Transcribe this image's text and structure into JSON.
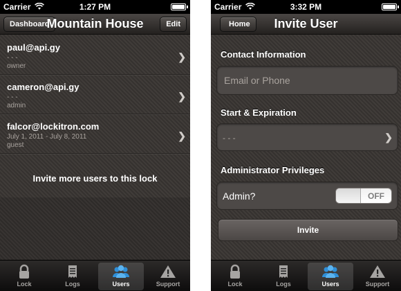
{
  "left": {
    "status": {
      "carrier": "Carrier",
      "time": "1:27 PM"
    },
    "navbar": {
      "left_button": "Dashboard",
      "title": "Mountain House",
      "right_button": "Edit"
    },
    "users": [
      {
        "email": "paul@api.gy",
        "dates": "- - -",
        "role": "owner"
      },
      {
        "email": "cameron@api.gy",
        "dates": "- - -",
        "role": "admin"
      },
      {
        "email": "falcor@lockitron.com",
        "dates": "July 1, 2011 - July 8, 2011",
        "role": "guest"
      }
    ],
    "invite_more": "Invite more users to this lock"
  },
  "right": {
    "status": {
      "carrier": "Carrier",
      "time": "3:32 PM"
    },
    "navbar": {
      "back_button": "Home",
      "title": "Invite User"
    },
    "contact": {
      "label": "Contact Information",
      "placeholder": "Email or Phone"
    },
    "dates": {
      "label": "Start & Expiration",
      "value": "- - -"
    },
    "admin": {
      "label": "Administrator Privileges",
      "field_label": "Admin?",
      "toggle_state": "OFF"
    },
    "invite_button": "Invite"
  },
  "tabs": [
    {
      "label": "Lock",
      "icon": "lock-icon"
    },
    {
      "label": "Logs",
      "icon": "logs-icon"
    },
    {
      "label": "Users",
      "icon": "users-icon"
    },
    {
      "label": "Support",
      "icon": "warning-icon"
    }
  ],
  "active_tab": "Users",
  "colors": {
    "active_tab_icon": "#2f8fd8",
    "inactive_tab_icon": "#a6a4a2"
  }
}
